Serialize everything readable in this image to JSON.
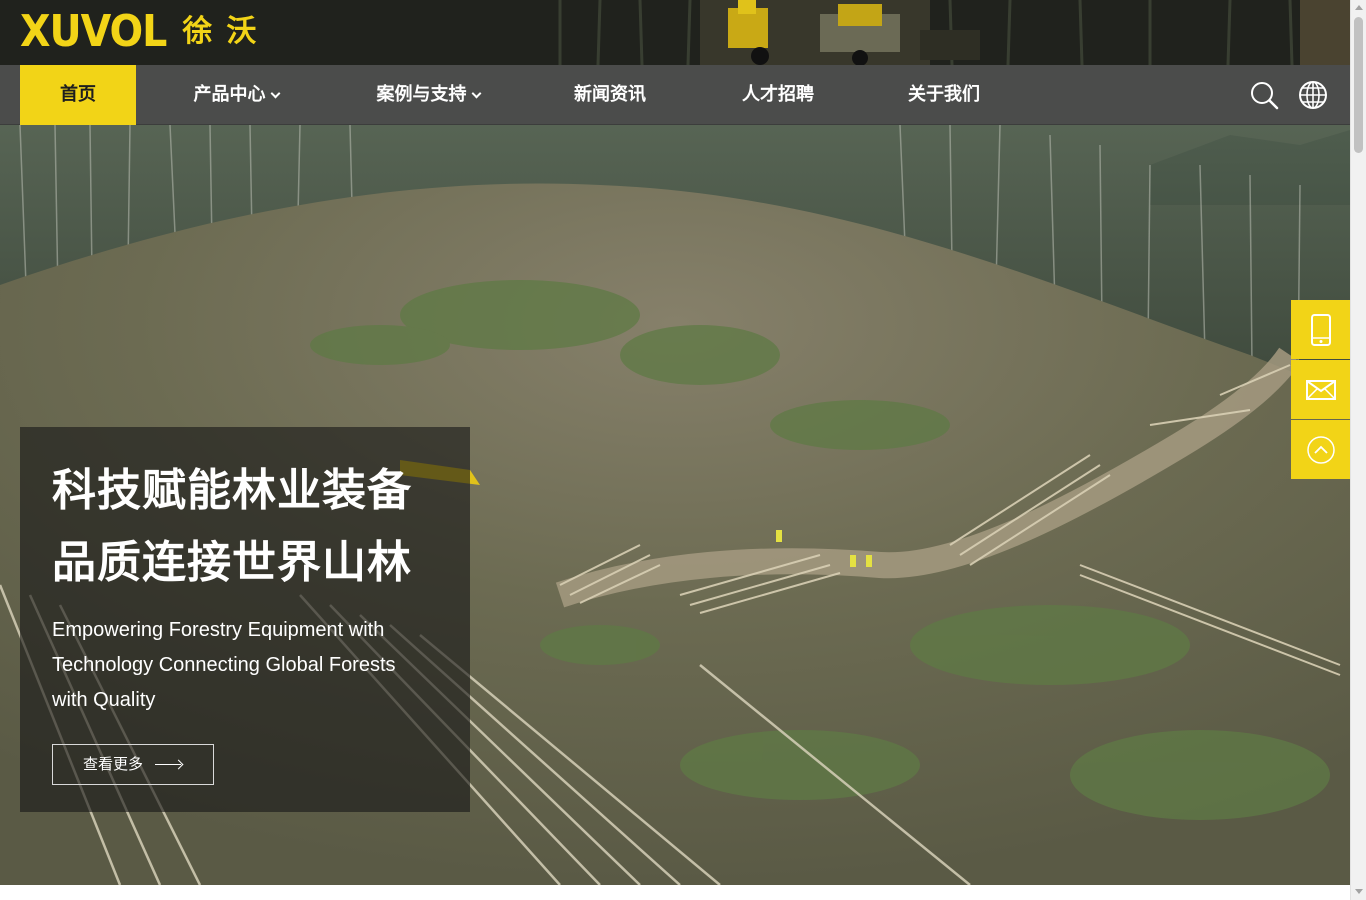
{
  "brand": {
    "logo_latin": "XUVOL",
    "logo_cn": "徐沃",
    "accent_color": "#f2d417"
  },
  "nav": {
    "items": [
      {
        "label": "首页",
        "active": true
      },
      {
        "label": "产品中心",
        "has_dropdown": true
      },
      {
        "label": "案例与支持",
        "has_dropdown": true
      },
      {
        "label": "新闻资讯"
      },
      {
        "label": "人才招聘"
      },
      {
        "label": "关于我们"
      }
    ],
    "icons": [
      "search-icon",
      "globe-icon"
    ]
  },
  "hero": {
    "title_line1": "科技赋能林业装备",
    "title_line2": "品质连接世界山林",
    "subtitle": "Empowering Forestry Equipment with Technology Connecting Global Forests with Quality",
    "button_label": "查看更多"
  },
  "side_float": {
    "icons": [
      "mobile-phone-icon",
      "mail-icon",
      "back-to-top-icon"
    ]
  }
}
